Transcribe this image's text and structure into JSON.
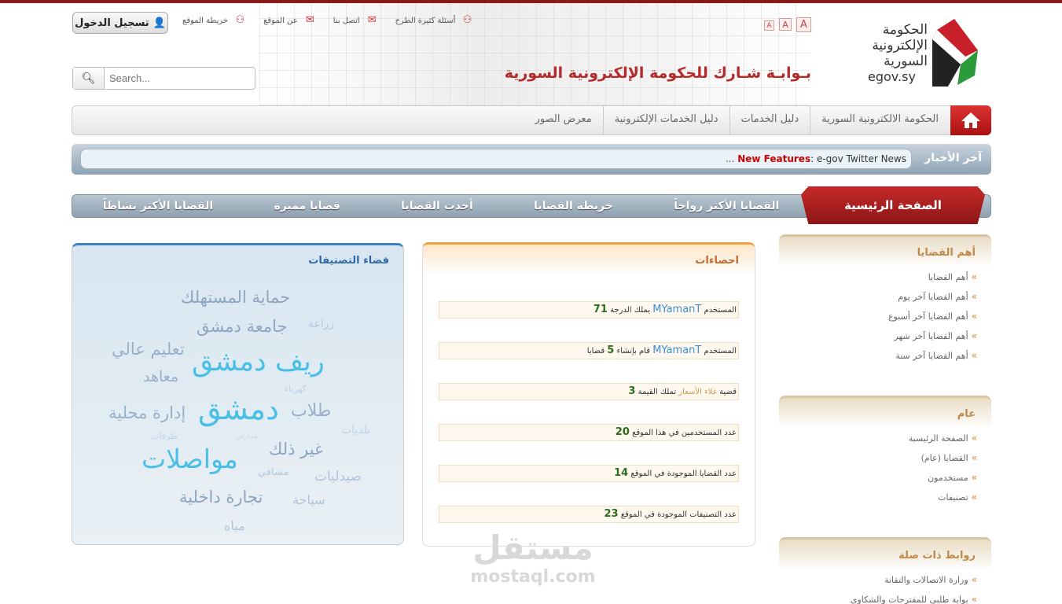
{
  "logo": {
    "line1": "الحكومة",
    "line2": "الإلكترونية",
    "line3": "السورية",
    "url": "egov.sy"
  },
  "site_title": "بـوابـة شـارك للحكومة الإلكترونية السورية",
  "font_sizes": [
    "A",
    "A",
    "A"
  ],
  "top_links": [
    {
      "label": "أسئلة كثيرة الطرح",
      "icon": "sitemap-icon"
    },
    {
      "label": "اتصل بنا",
      "icon": "mail-icon"
    },
    {
      "label": "عن الموقع",
      "icon": "mail-icon"
    },
    {
      "label": "خريطة الموقع",
      "icon": "sitemap-icon"
    }
  ],
  "login_label": "تسجيل الدخول",
  "search": {
    "placeholder": "Search..."
  },
  "main_nav": [
    "الحكومة الالكترونية السورية",
    "دليل الخدمات",
    "دليل الخدمات الإلكترونية",
    "معرض الصور"
  ],
  "news": {
    "title": "آخر الأخبار",
    "feature_label": "New Features",
    "headline": ": e-gov Twitter News",
    "more": "..."
  },
  "issue_nav": {
    "home": "الصفحة الرئيسية",
    "items": [
      "القضايا الأكثر رواجاً",
      "خريطة القضايا",
      "أحدث القضايا",
      "قضايا مميزة",
      "القضايا الأكثر نشاطاً"
    ]
  },
  "sidebar": [
    {
      "title": "أهم القضايا",
      "items": [
        "أهم القضايا",
        "أهم القضايا آخر يوم",
        "أهم القضايا آخر أسبوع",
        "أهم القضايا آخر شهر",
        "أهم القضايا آخر سنة"
      ]
    },
    {
      "title": "عام",
      "items": [
        "الصفحة الرئيسية",
        "القضايا (عام)",
        "مستخدمون",
        "تصنيفات"
      ]
    },
    {
      "title": "روابط ذات صلة",
      "items": [
        "وزارة الاتصالات والتقانة",
        "بوابة طلبي للمقترحات والشكاوى"
      ]
    }
  ],
  "stats": {
    "title": "احصاءات",
    "rows": [
      {
        "pre": "المستخدم",
        "user": "MYamanT",
        "mid": "يملك الدرجة",
        "num": "71"
      },
      {
        "pre": "المستخدم",
        "user": "MYamanT",
        "mid": "قام بإنشاء",
        "num": "5",
        "post": "قضايا"
      },
      {
        "pre": "قضية",
        "tag": "غلاء الأسعار",
        "mid": "تملك القيمة",
        "num": "3"
      },
      {
        "pre": "عدد المستخدمين في هذا الموقع",
        "num": "20"
      },
      {
        "pre": "عدد القضايا الموجودة في الموقع",
        "num": "14"
      },
      {
        "pre": "عدد التصنيفات الموجودة في الموقع",
        "num": "23"
      }
    ]
  },
  "tag_cloud": {
    "title": "فضاء التصنيفات",
    "tags": [
      "حماية المستهلك",
      "زراعة",
      "جامعة دمشق",
      "تعليم عالي",
      "ريف دمشق",
      "معاهد",
      "كهرباء",
      "طلاب",
      "دمشق",
      "إدارة محلية",
      "بلديات",
      "طرقات",
      "مدارس",
      "غير ذلك",
      "مواصلات",
      "مشافي",
      "صيدليات",
      "تجارة داخلية",
      "سياحة",
      "مياه"
    ]
  },
  "watermark": {
    "arabic": "مستقل",
    "latin": "mostaql.com"
  },
  "colors": {
    "accent_red": "#b52a2a",
    "news_blue": "#8ea3b4",
    "tag_blue": "#3b7fc0",
    "stat_orange": "#f0a040"
  }
}
